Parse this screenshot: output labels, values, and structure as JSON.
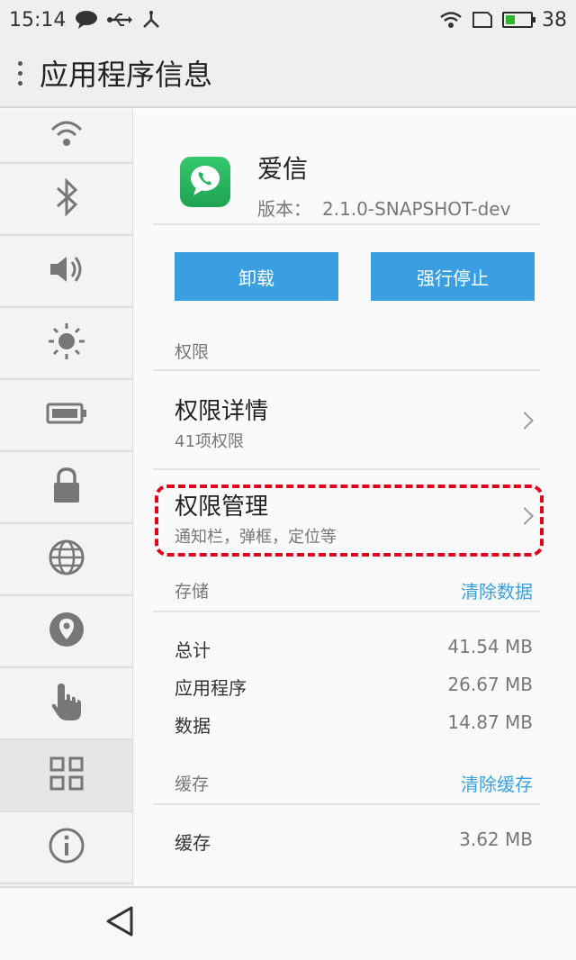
{
  "status_bar": {
    "time": "15:14",
    "battery": "38",
    "battery_level": 0.38,
    "icons_left": [
      "chat-bubble-icon",
      "usb-icon",
      "debug-icon"
    ],
    "icons_right": [
      "wifi-icon",
      "sim-icon",
      "battery-icon"
    ]
  },
  "header": {
    "title": "应用程序信息"
  },
  "sidebar": {
    "items": [
      {
        "icon": "wifi-icon"
      },
      {
        "icon": "bluetooth-icon"
      },
      {
        "icon": "volume-icon"
      },
      {
        "icon": "brightness-icon"
      },
      {
        "icon": "battery-icon"
      },
      {
        "icon": "lock-icon"
      },
      {
        "icon": "globe-icon"
      },
      {
        "icon": "location-icon"
      },
      {
        "icon": "touch-icon"
      },
      {
        "icon": "apps-grid-icon",
        "active": true
      },
      {
        "icon": "info-icon"
      }
    ]
  },
  "app": {
    "name": "爱信",
    "version_label": "版本：",
    "version_value": "2.1.0-SNAPSHOT-dev",
    "icon": "chat-phone-icon"
  },
  "buttons": {
    "uninstall": "卸载",
    "force_stop": "强行停止"
  },
  "permissions": {
    "section": "权限",
    "details_title": "权限详情",
    "details_sub": "41项权限",
    "manage_title": "权限管理",
    "manage_sub": "通知栏，弹框，定位等"
  },
  "storage": {
    "section": "存储",
    "clear_action": "清除数据",
    "rows": [
      {
        "label": "总计",
        "value": "41.54 MB"
      },
      {
        "label": "应用程序",
        "value": "26.67 MB"
      },
      {
        "label": "数据",
        "value": "14.87 MB"
      }
    ]
  },
  "cache": {
    "section": "缓存",
    "clear_action": "清除缓存",
    "rows": [
      {
        "label": "缓存",
        "value": "3.62 MB"
      }
    ]
  },
  "colors": {
    "accent": "#3a9fe0",
    "highlight": "#e0001b"
  }
}
